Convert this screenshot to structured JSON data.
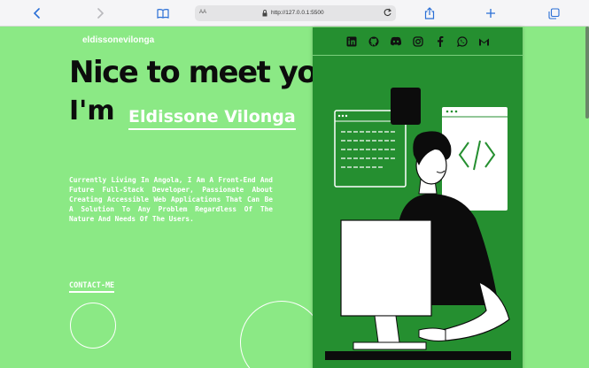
{
  "browser": {
    "url": "http://127.0.0.1:5500",
    "reader_label": "AA",
    "icons": [
      "back-icon",
      "forward-icon",
      "book-icon",
      "lock-icon",
      "reload-icon",
      "share-icon",
      "plus-icon",
      "tabs-icon"
    ]
  },
  "page": {
    "brand": "eldissonevilonga",
    "headline": "Nice to meet you!",
    "im": "I'm",
    "name": "Eldissone Vilonga",
    "description": "Currently Living In Angola, I Am A Front-End And Future Full-Stack Developer, Passionate About Creating Accessible Web Applications That Can Be A Solution To Any Problem Regardless Of The Nature And Needs Of The Users.",
    "contact": "CONTACT-ME",
    "socials": [
      "linkedin-icon",
      "github-icon",
      "discord-icon",
      "instagram-icon",
      "facebook-icon",
      "whatsapp-icon",
      "gmail-icon"
    ]
  },
  "colors": {
    "background": "#8be985",
    "card": "#258f30",
    "text_dark": "#0c0c0c",
    "text_light": "#ffffff"
  }
}
